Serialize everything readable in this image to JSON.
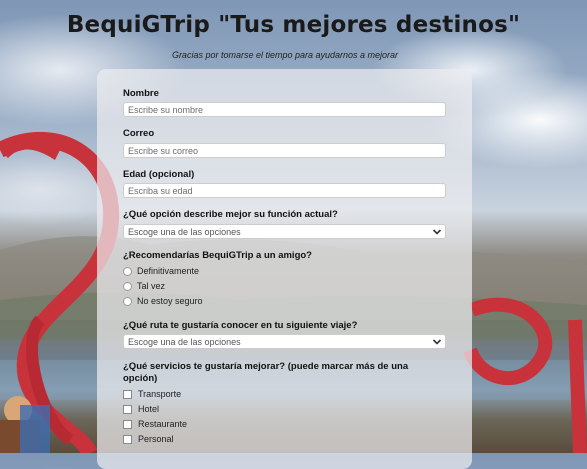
{
  "header": {
    "title": "BequiGTrip \"Tus mejores destinos\"",
    "subtitle": "Gracias por tomarse el tiempo para ayudarnos a mejorar"
  },
  "form": {
    "name": {
      "label": "Nombre",
      "placeholder": "Escribe su nombre"
    },
    "email": {
      "label": "Correo",
      "placeholder": "Escribe su correo"
    },
    "age": {
      "label": "Edad (opcional)",
      "placeholder": "Escriba su edad"
    },
    "role": {
      "label": "¿Qué opción describe mejor su función actual?",
      "selected": "Escoge una de las opciones"
    },
    "recommend": {
      "label": "¿Recomendarías BequiGTrip a un amigo?",
      "options": [
        "Definitivamente",
        "Tal vez",
        "No estoy seguro"
      ]
    },
    "route": {
      "label": "¿Qué ruta te gustaría conocer en tu siguiente viaje?",
      "selected": "Escoge una de las opciones"
    },
    "services": {
      "label": "¿Qué servicios te gustaría mejorar? (puede marcar más de una opción)",
      "options": [
        "Transporte",
        "Hotel",
        "Restaurante",
        "Personal"
      ]
    }
  },
  "icons": {
    "select_arrow": "chevron-down-icon"
  },
  "colors": {
    "sculpture_red": "#c8323a",
    "card": "#ebebee"
  }
}
